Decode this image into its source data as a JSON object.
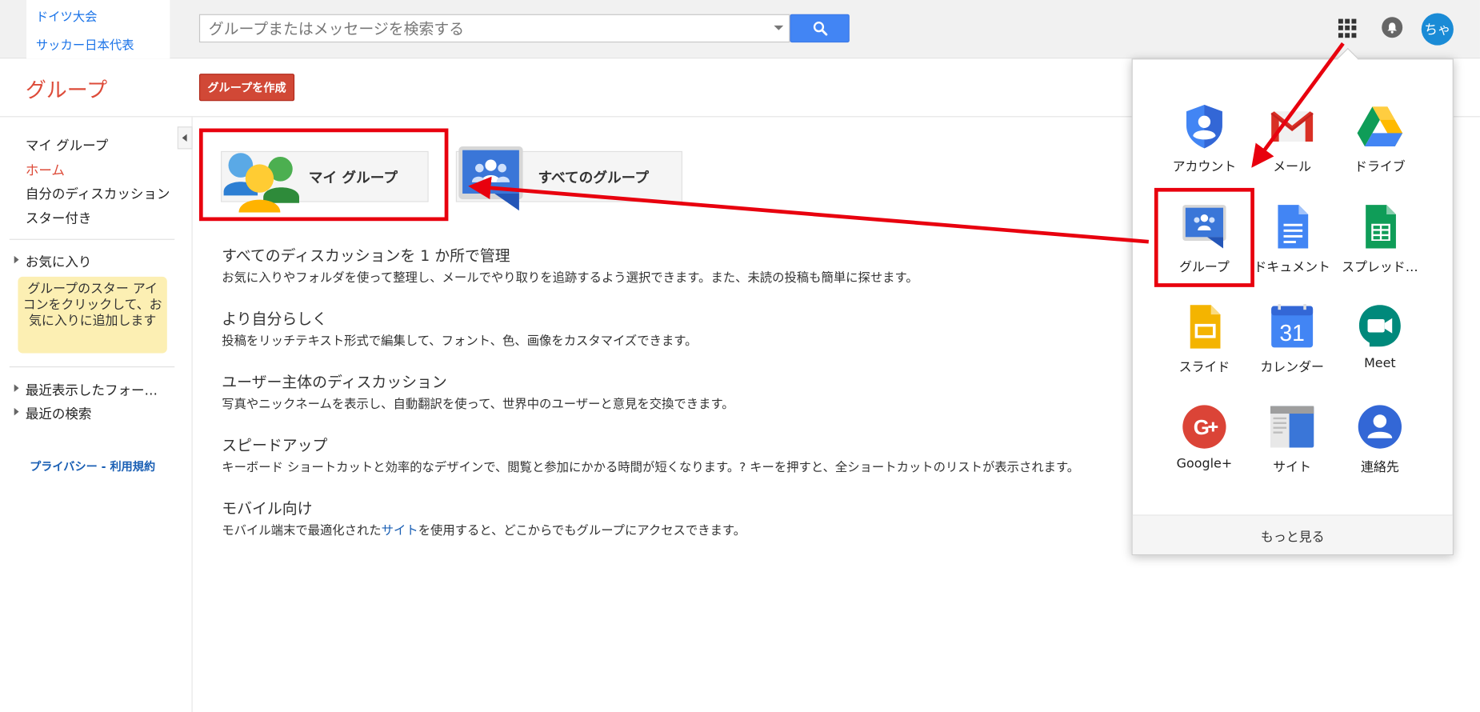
{
  "topbar": {
    "saved_items": [
      "ドイツ大会",
      "サッカー日本代表"
    ],
    "search_placeholder": "グループまたはメッセージを検索する",
    "avatar_initials": "ちゃ"
  },
  "header": {
    "brand": "グループ",
    "create_button": "グループを作成"
  },
  "sidebar": {
    "nav": [
      "マイ グループ",
      "ホーム",
      "自分のディスカッション",
      "スター付き"
    ],
    "favorites_label": "お気に入り",
    "favorites_tip": "グループのスター アイコンをクリックして、お気に入りに追加します",
    "recent_folders": "最近表示したフォー…",
    "recent_searches": "最近の検索",
    "footer": "プライバシー - 利用規約"
  },
  "main": {
    "my_groups_button": "マイ グループ",
    "all_groups_button": "すべてのグループ",
    "features": [
      {
        "title": "すべてのディスカッションを 1 か所で管理",
        "desc": "お気に入りやフォルダを使って整理し、メールでやり取りを追跡するよう選択できます。また、未読の投稿も簡単に探せます。"
      },
      {
        "title": "より自分らしく",
        "desc": "投稿をリッチテキスト形式で編集して、フォント、色、画像をカスタマイズできます。"
      },
      {
        "title": "ユーザー主体のディスカッション",
        "desc": "写真やニックネームを表示し、自動翻訳を使って、世界中のユーザーと意見を交換できます。"
      },
      {
        "title": "スピードアップ",
        "desc": "キーボード ショートカットと効率的なデザインで、閲覧と参加にかかる時間が短くなります。? キーを押すと、全ショートカットのリストが表示されます。"
      },
      {
        "title": "モバイル向け",
        "desc_before": "モバイル端末で最適化された",
        "desc_link": "サイト",
        "desc_after": "を使用すると、どこからでもグループにアクセスできます。"
      }
    ]
  },
  "launcher": {
    "apps": [
      {
        "label": "アカウント",
        "icon": "account-icon"
      },
      {
        "label": "メール",
        "icon": "gmail-icon"
      },
      {
        "label": "ドライブ",
        "icon": "drive-icon"
      },
      {
        "label": "グループ",
        "icon": "groups-icon"
      },
      {
        "label": "ドキュメント",
        "icon": "docs-icon"
      },
      {
        "label": "スプレッド…",
        "icon": "sheets-icon"
      },
      {
        "label": "スライド",
        "icon": "slides-icon"
      },
      {
        "label": "カレンダー",
        "icon": "calendar-icon"
      },
      {
        "label": "Meet",
        "icon": "meet-icon"
      },
      {
        "label": "Google+",
        "icon": "google-plus-icon"
      },
      {
        "label": "サイト",
        "icon": "sites-icon"
      },
      {
        "label": "連絡先",
        "icon": "contacts-icon"
      }
    ],
    "calendar_day": "31",
    "more_label": "もっと見る"
  },
  "colors": {
    "brand_red": "#dd4b39",
    "search_blue": "#4285f4",
    "annotation_red": "#e8000e"
  }
}
